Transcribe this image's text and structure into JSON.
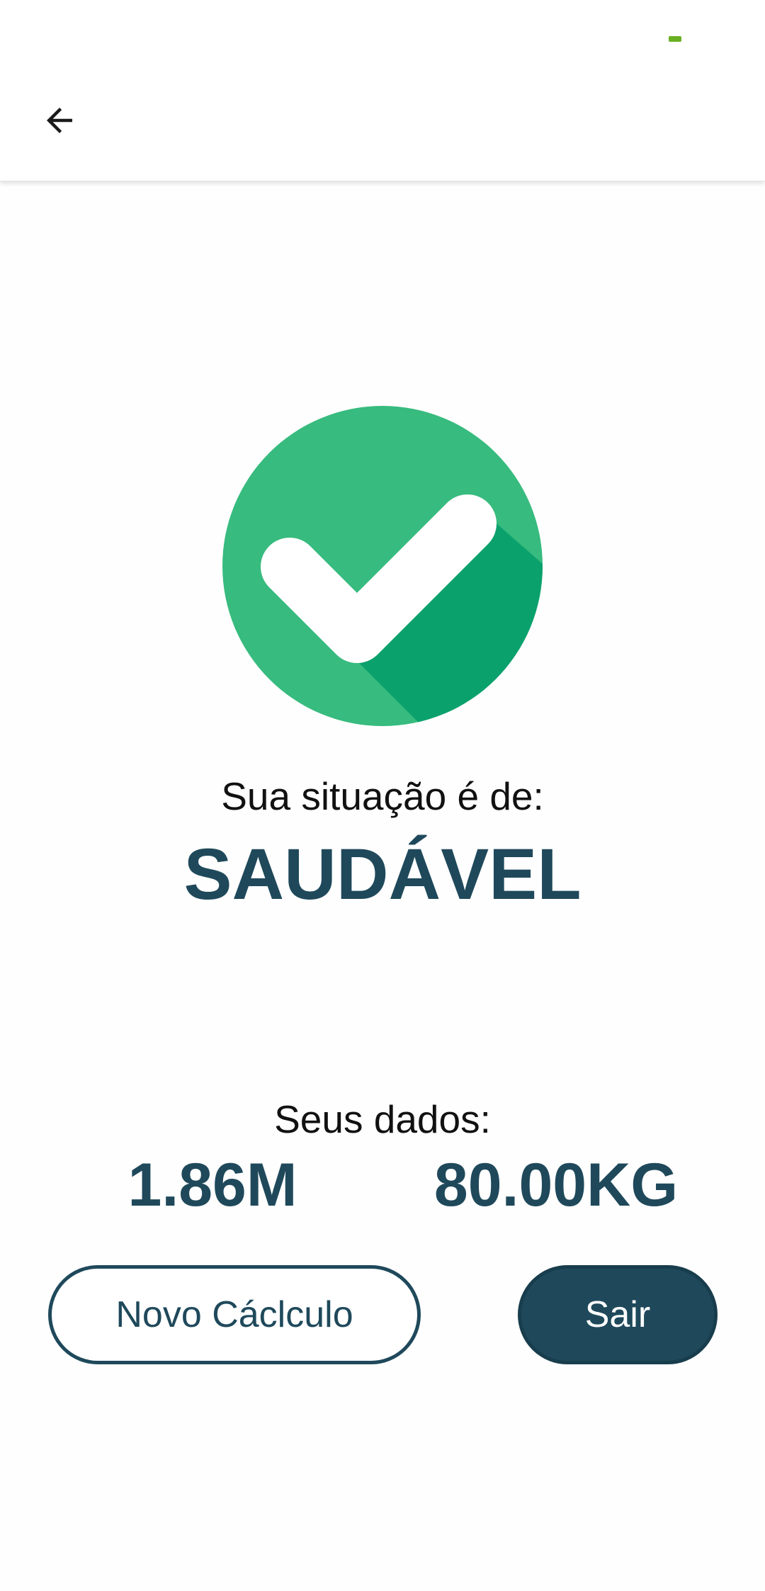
{
  "appbar": {
    "back_icon": "arrow-left-icon",
    "indicator_color": "#6ab023"
  },
  "result": {
    "icon": "check-circle-icon",
    "icon_colors": {
      "circle": "#37bb7e",
      "shadow": "#0ba16d",
      "check": "#ffffff"
    },
    "label": "Sua situação é de:",
    "status": "SAUDÁVEL"
  },
  "data": {
    "label": "Seus dados:",
    "height": "1.86M",
    "weight": "80.00KG"
  },
  "actions": {
    "new_calc_label": "Novo Cáclculo",
    "exit_label": "Sair"
  },
  "colors": {
    "primary": "#1f495b",
    "text": "#111111",
    "background": "#fefefe"
  }
}
